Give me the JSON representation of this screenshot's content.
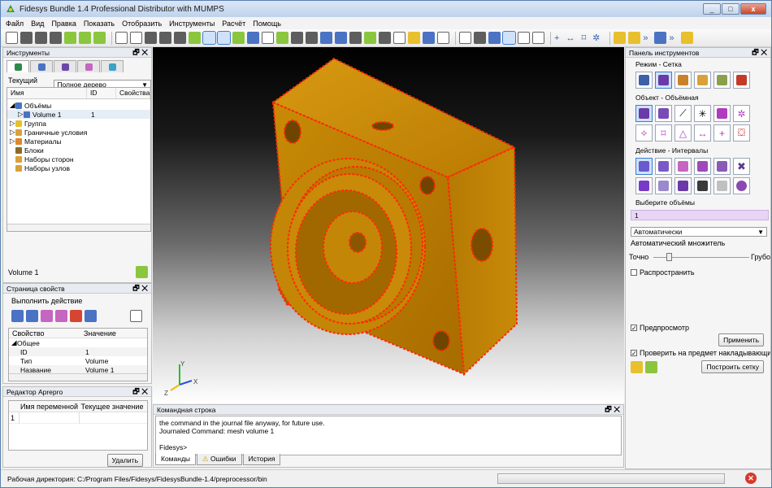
{
  "window": {
    "title": "Fidesys Bundle 1.4 Professional Distributor with MUMPS"
  },
  "menu": [
    "Файл",
    "Вид",
    "Правка",
    "Показать",
    "Отобразить",
    "Инструменты",
    "Расчёт",
    "Помощь"
  ],
  "instruments": {
    "title": "Инструменты",
    "view_label": "Текущий вид",
    "view_value": "Полное дерево",
    "col_name": "Имя",
    "col_id": "ID",
    "col_props": "Свойства",
    "items": [
      {
        "label": "Объёмы",
        "id": ""
      },
      {
        "label": "Volume 1",
        "id": "1"
      },
      {
        "label": "Группа",
        "id": ""
      },
      {
        "label": "Граничные условия",
        "id": ""
      },
      {
        "label": "Материалы",
        "id": ""
      },
      {
        "label": "Блоки",
        "id": ""
      },
      {
        "label": "Наборы сторон",
        "id": ""
      },
      {
        "label": "Наборы узлов",
        "id": ""
      }
    ],
    "selected_text": "Volume 1"
  },
  "properties": {
    "title": "Страница свойств",
    "action_label": "Выполнить действие",
    "col_prop": "Свойство",
    "col_value": "Значение",
    "rows": [
      {
        "k": "Общее",
        "v": ""
      },
      {
        "k": "ID",
        "v": "1"
      },
      {
        "k": "Тип",
        "v": "Volume"
      },
      {
        "k": "Название",
        "v": "Volume 1"
      }
    ]
  },
  "aprepro": {
    "title": "Редактор Aprepro",
    "col_var": "Имя переменной",
    "col_val": "Текущее значение",
    "row_num": "1",
    "delete_label": "Удалить"
  },
  "command": {
    "title": "Командная строка",
    "lines": [
      "the command in the journal file anyway, for future use.",
      "Journaled Command: mesh volume 1",
      "",
      "Fidesys>"
    ],
    "tabs": [
      "Команды",
      "Ошибки",
      "История"
    ]
  },
  "toolpanel": {
    "title": "Панель инструментов",
    "mode": "Режим - Сетка",
    "object": "Объект - Объёмная",
    "action": "Действие - Интервалы",
    "select_label": "Выберите объёмы",
    "select_value": "1",
    "auto_value": "Автоматически",
    "auto_mult": "Автоматический множитель",
    "fine": "Точно",
    "coarse": "Грубо",
    "propagate": "Распространить",
    "preview": "Предпросмотр",
    "apply": "Применить",
    "check_overlap": "Проверить на предмет накладывающихся повт",
    "build_mesh": "Построить сетку"
  },
  "axes": {
    "x": "X",
    "y": "Y",
    "z": "Z"
  },
  "status": {
    "workdir": "Рабочая директория: C:/Program Files/Fidesys/FidesysBundle-1.4/preprocessor/bin"
  },
  "colors": {
    "model": "#c98a06",
    "edge": "#ff2a00",
    "accent": "#3c7fd1"
  }
}
